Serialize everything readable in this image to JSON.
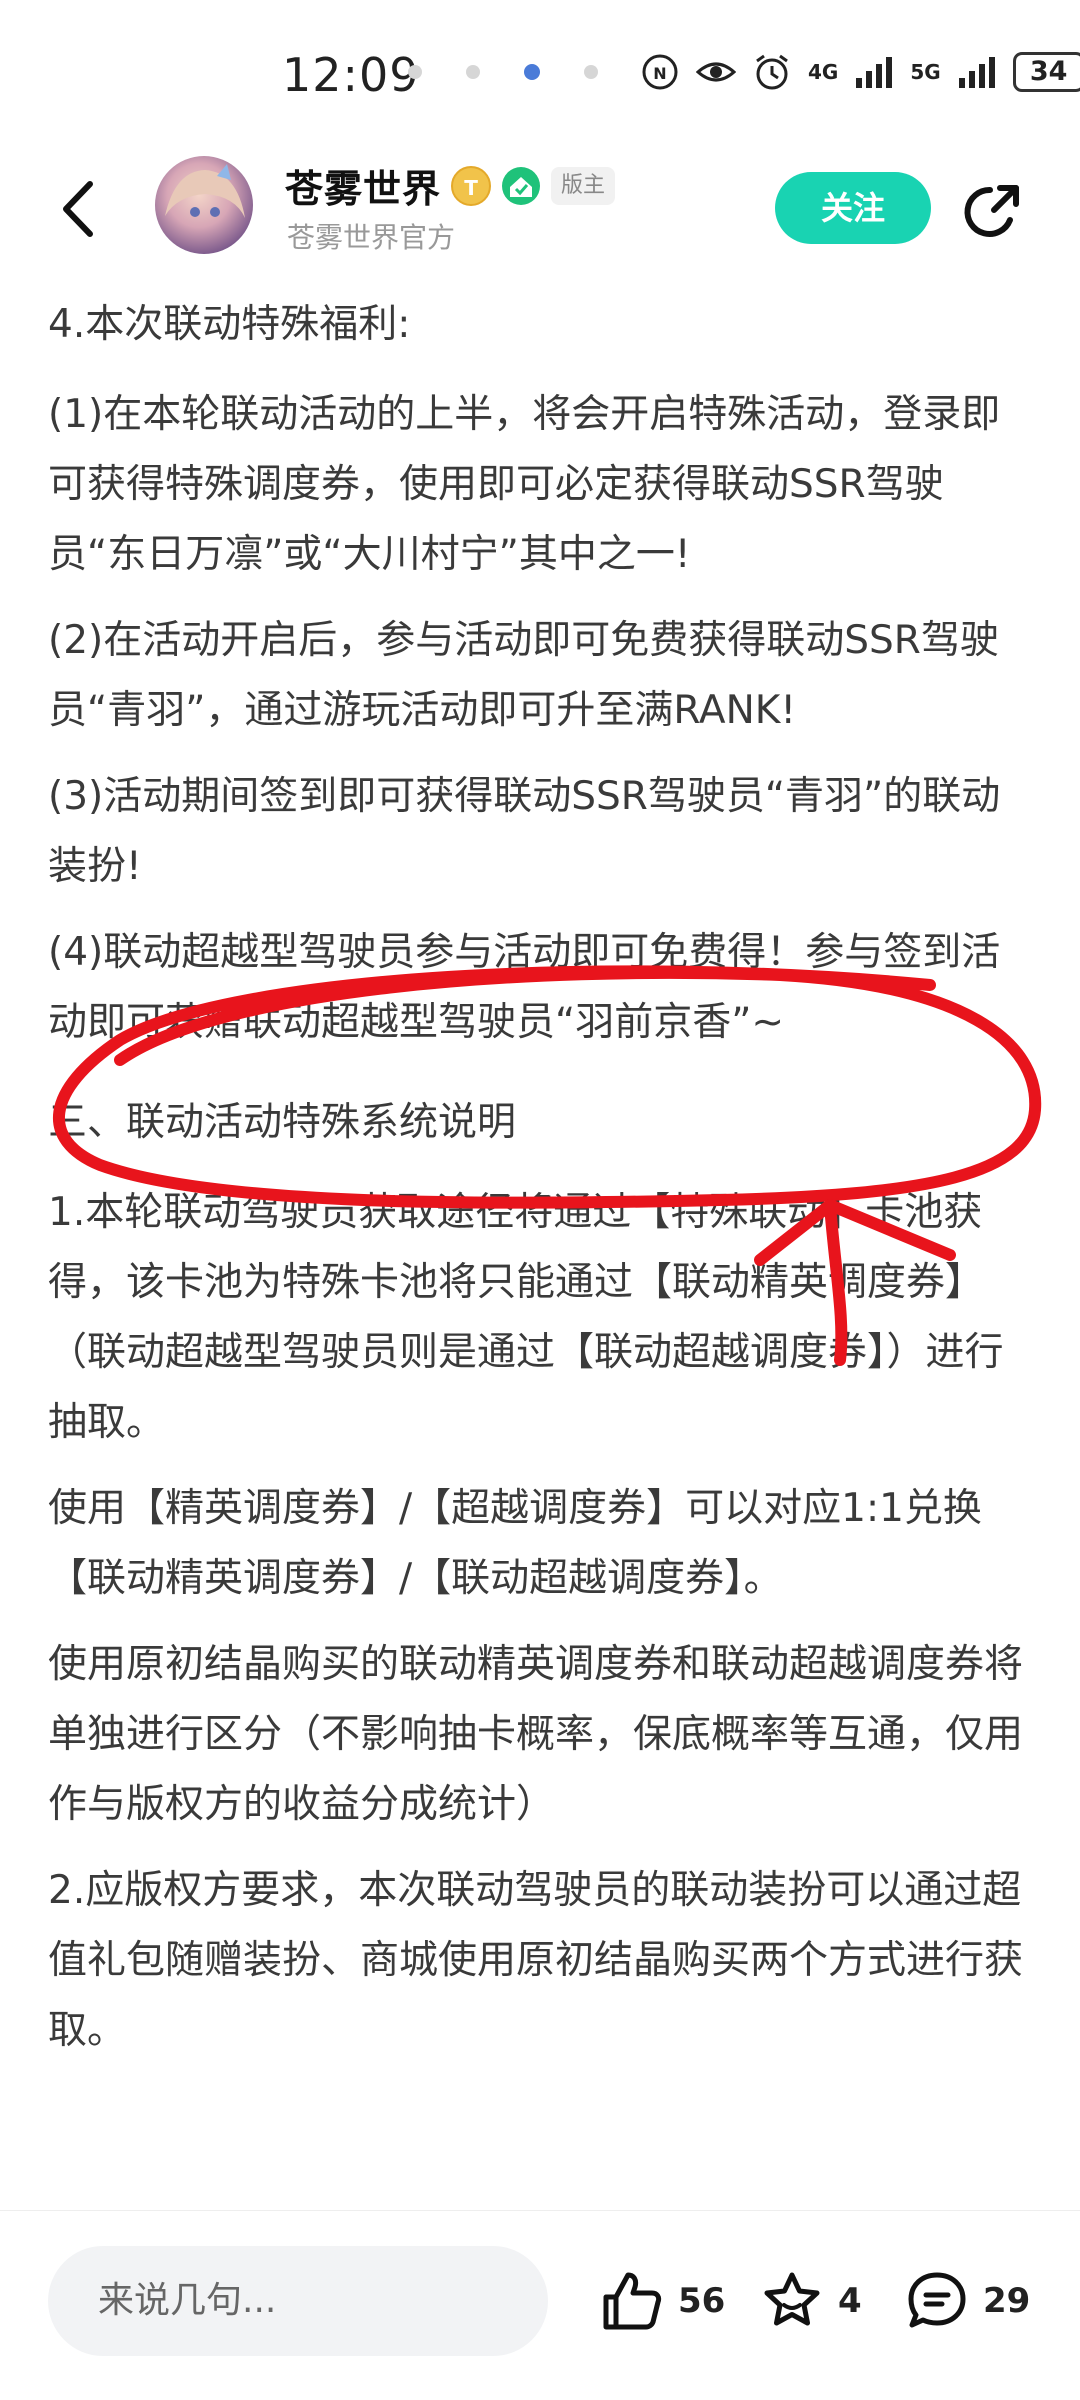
{
  "status_bar": {
    "time": "12:09",
    "signal_1": "4G",
    "signal_2": "5G",
    "battery": "34"
  },
  "header": {
    "title": "苍雾世界",
    "badge_t": "T",
    "mod_tag": "版主",
    "subtitle": "苍雾世界官方",
    "follow_label": "关注"
  },
  "content": {
    "paragraphs": [
      "4.本次联动特殊福利:",
      "(1)在本轮联动活动的上半，将会开启特殊活动，登录即可获得特殊调度券，使用即可必定获得联动SSR驾驶员“东日万凛”或“大川村宁”其中之一!",
      "(2)在活动开启后，参与活动即可免费获得联动SSR驾驶员“青羽”，通过游玩活动即可升至满RANK!",
      "(3)活动期间签到即可获得联动SSR驾驶员“青羽”的联动装扮!",
      "(4)联动超越型驾驶员参与活动即可免费得！参与签到活动即可获赠联动超越型驾驶员“羽前京香”~",
      "三、联动活动特殊系统说明",
      "1.本轮联动驾驶员获取途径将通过【特殊联动】卡池获得，该卡池为特殊卡池将只能通过【联动精英调度券】（联动超越型驾驶员则是通过【联动超越调度券】）进行抽取。",
      "使用【精英调度券】/【超越调度券】可以对应1:1兑换【联动精英调度券】/【联动超越调度券】。",
      "使用原初结晶购买的联动精英调度券和联动超越调度券将单独进行区分（不影响抽卡概率，保底概率等互通，仅用作与版权方的收益分成统计）",
      "2.应版权方要求，本次联动驾驶员的联动装扮可以通过超值礼包随赠装扮、商城使用原初结晶购买两个方式进行获取。"
    ]
  },
  "bottom_bar": {
    "comment_placeholder": "来说几句...",
    "like_count": "56",
    "favorite_count": "4",
    "comment_count": "29"
  },
  "icons": {
    "back": "back-arrow-icon",
    "share": "share-icon",
    "like": "thumbs-up-icon",
    "favorite": "star-icon",
    "comment": "comment-bubble-icon"
  },
  "colors": {
    "accent": "#19d3b2",
    "annotation": "#e8141c"
  }
}
